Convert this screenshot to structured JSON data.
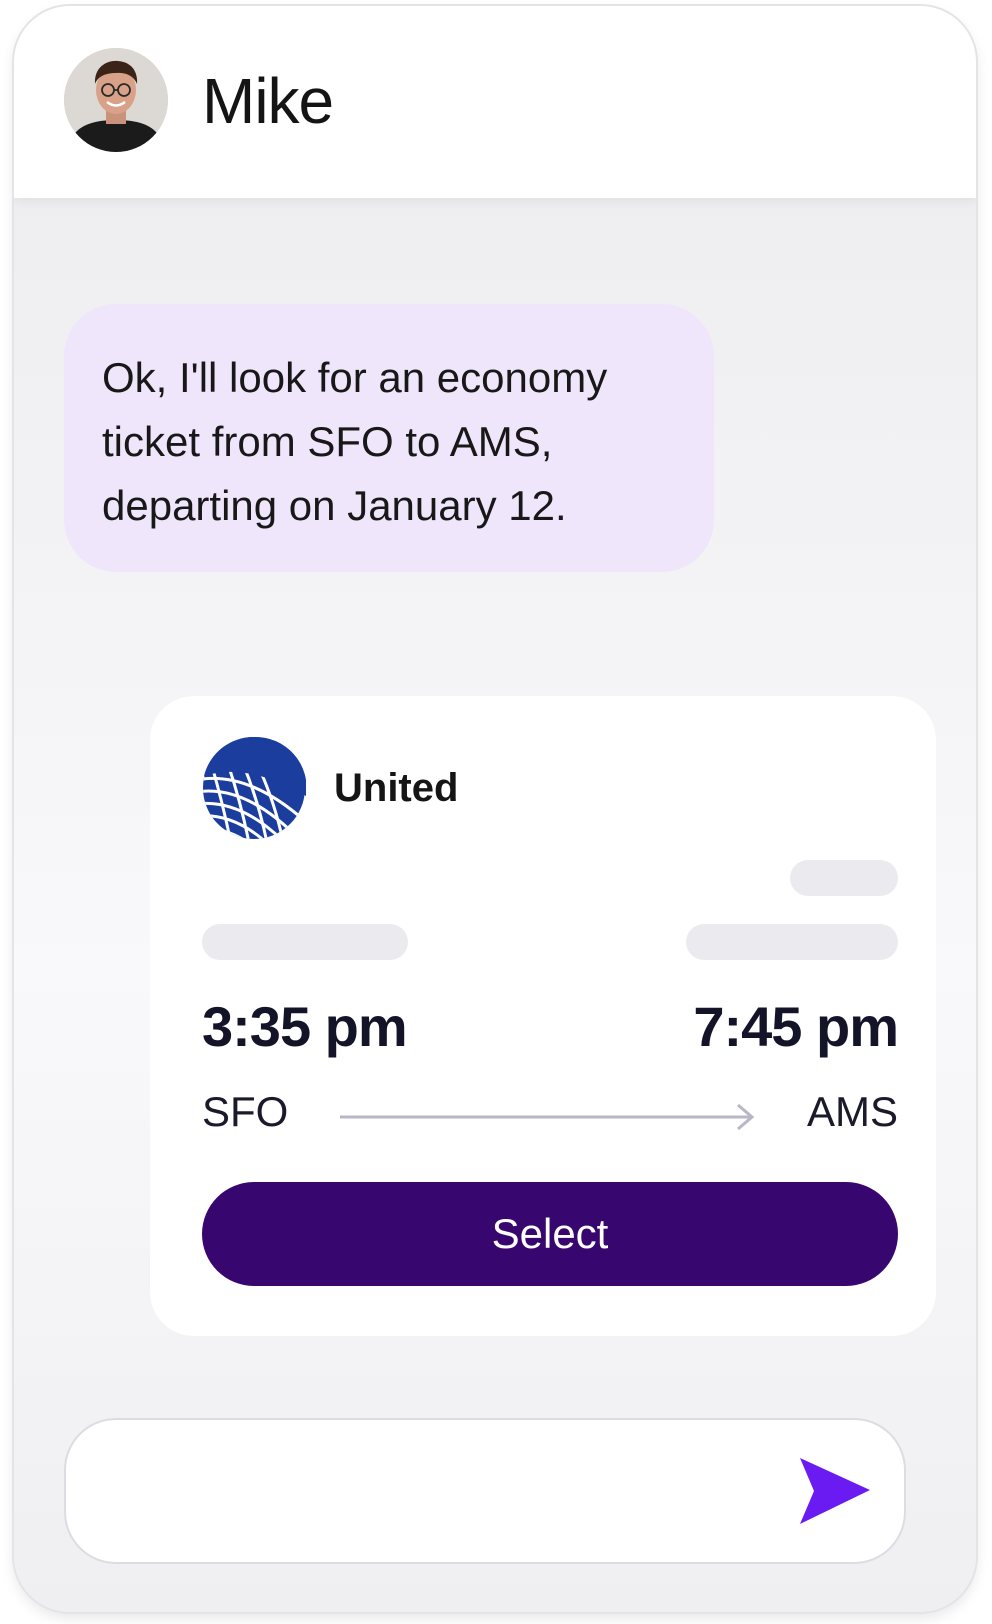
{
  "header": {
    "contact_name": "Mike",
    "avatar_icon": "person-avatar"
  },
  "messages": [
    {
      "sender": "assistant",
      "text": "Ok, I'll look for an economy ticket from SFO to AMS, departing on January 12."
    }
  ],
  "flight_card": {
    "airline": "United",
    "airline_logo_icon": "united-globe-logo",
    "departure_time": "3:35 pm",
    "arrival_time": "7:45 pm",
    "origin": "SFO",
    "destination": "AMS",
    "select_label": "Select"
  },
  "composer": {
    "placeholder": "",
    "send_icon": "send-arrow-icon"
  },
  "colors": {
    "bubble_bg": "#efe6fb",
    "select_button_bg": "#37066f",
    "send_icon": "#6a1bf2",
    "airline_blue": "#1b3d9e"
  }
}
